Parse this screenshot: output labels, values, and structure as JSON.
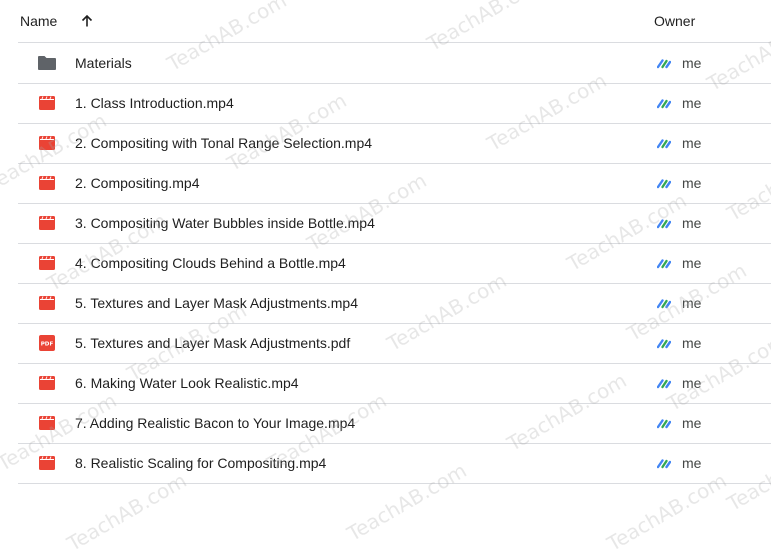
{
  "header": {
    "name_label": "Name",
    "sort_icon": "arrow-up-icon",
    "owner_label": "Owner"
  },
  "files": [
    {
      "name": "Materials",
      "type": "folder",
      "icon": "folder-icon",
      "owner": "me"
    },
    {
      "name": "1. Class Introduction.mp4",
      "type": "video",
      "icon": "video-icon",
      "owner": "me"
    },
    {
      "name": "2. Compositing with Tonal Range Selection.mp4",
      "type": "video",
      "icon": "video-icon",
      "owner": "me"
    },
    {
      "name": "2. Compositing.mp4",
      "type": "video",
      "icon": "video-icon",
      "owner": "me"
    },
    {
      "name": "3. Compositing Water Bubbles inside Bottle.mp4",
      "type": "video",
      "icon": "video-icon",
      "owner": "me"
    },
    {
      "name": "4. Compositing Clouds Behind a Bottle.mp4",
      "type": "video",
      "icon": "video-icon",
      "owner": "me"
    },
    {
      "name": "5. Textures and Layer Mask Adjustments.mp4",
      "type": "video",
      "icon": "video-icon",
      "owner": "me"
    },
    {
      "name": "5. Textures and Layer Mask Adjustments.pdf",
      "type": "pdf",
      "icon": "pdf-icon",
      "owner": "me"
    },
    {
      "name": "6. Making Water Look Realistic.mp4",
      "type": "video",
      "icon": "video-icon",
      "owner": "me"
    },
    {
      "name": "7. Adding Realistic Bacon to Your Image.mp4",
      "type": "video",
      "icon": "video-icon",
      "owner": "me"
    },
    {
      "name": "8. Realistic Scaling for Compositing.mp4",
      "type": "video",
      "icon": "video-icon",
      "owner": "me"
    }
  ],
  "icons": {
    "pdf_label": "PDF"
  },
  "watermark": {
    "text": "TeachAB.com"
  },
  "colors": {
    "video": "#ea4335",
    "folder": "#5f6368",
    "divider": "#dadce0",
    "avatar_blue": "#4285f4",
    "avatar_green": "#34a853"
  }
}
